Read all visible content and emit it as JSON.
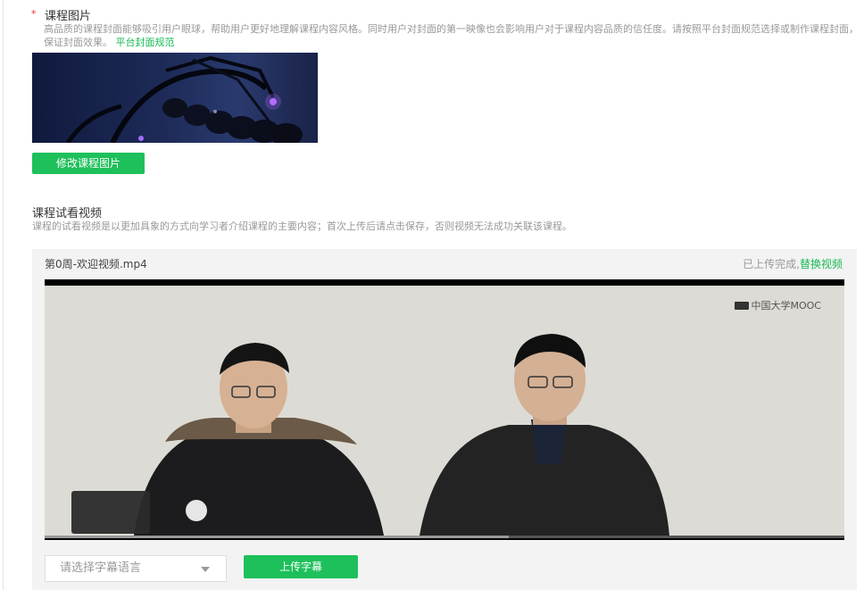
{
  "cover": {
    "required_mark": "*",
    "title": "课程图片",
    "description": "高品质的课程封面能够吸引用户眼球，帮助用户更好地理解课程内容风格。同时用户对封面的第一映像也会影响用户对于课程内容品质的信任度。请按照平台封面规范选择或制作课程封面，保证封面效果。",
    "guide_link": "平台封面规范",
    "change_button": "修改课程图片"
  },
  "video": {
    "title": "课程试看视频",
    "description": "课程的试看视频是以更加具象的方式向学习者介绍课程的主要内容；首次上传后请点击保存，否则视频无法成功关联该课程。",
    "filename": "第0周-欢迎视频.mp4",
    "status_text": "已上传完成,",
    "replace_link": "替换视频",
    "watermark": "中国大学MOOC",
    "progress": 0.58,
    "subtitle_placeholder": "请选择字幕语言",
    "upload_subtitle_button": "上传字幕"
  },
  "colors": {
    "accent": "#1dc05b",
    "required": "#e5322d",
    "muted_text": "#999999"
  }
}
